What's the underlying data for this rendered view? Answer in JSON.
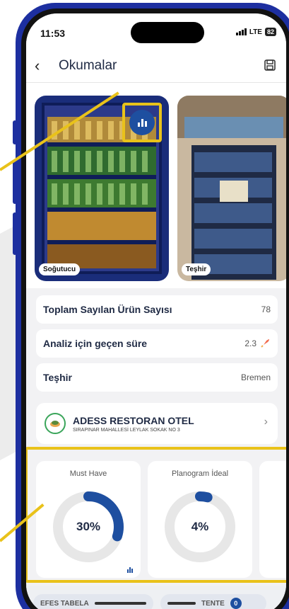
{
  "status": {
    "time": "11:53",
    "network": "LTE",
    "battery": "82"
  },
  "nav": {
    "title": "Okumalar"
  },
  "photos": [
    {
      "label": "Soğutucu"
    },
    {
      "label": "Teşhir"
    }
  ],
  "info_rows": [
    {
      "label": "Toplam Sayılan Ürün Sayısı",
      "value": "78"
    },
    {
      "label": "Analiz için geçen süre",
      "value": "2.3"
    },
    {
      "label": "Teşhir",
      "value": "Bremen"
    }
  ],
  "store": {
    "name": "ADESS RESTORAN OTEL",
    "address": "SIRAPINAR MAHALLESİ LEYLAK SOKAK NO 3"
  },
  "kpis": [
    {
      "title": "Must Have",
      "value": "30%",
      "percent": 30
    },
    {
      "title": "Planogram İdeal",
      "value": "4%",
      "percent": 4
    }
  ],
  "chips": [
    {
      "label": "EFES TABELA",
      "badge": ""
    },
    {
      "label": "TENTE",
      "badge": "0"
    }
  ],
  "colors": {
    "accent": "#1e4fa0",
    "highlight": "#e9c21a",
    "phone_frame": "#1d2fa0"
  }
}
